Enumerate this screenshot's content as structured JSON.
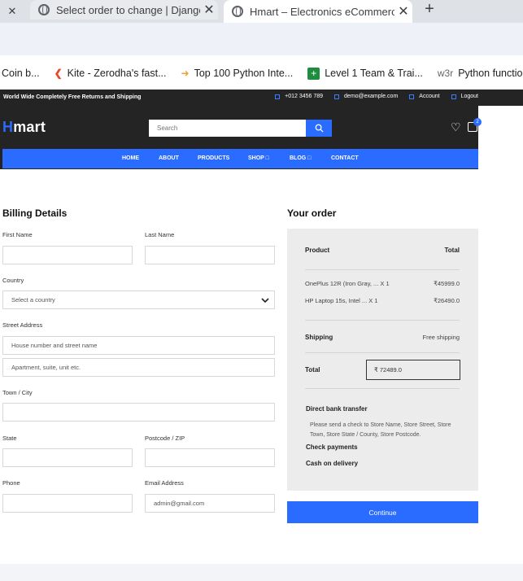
{
  "browser": {
    "tabs": [
      {
        "title": "",
        "close": "✕"
      },
      {
        "title": "Select order to change | Django",
        "close": "✕"
      },
      {
        "title": "Hmart – Electronics eCommerce",
        "close": "✕"
      }
    ],
    "new_tab": "+",
    "bookmarks": [
      {
        "label": "Coin b...",
        "icon": ""
      },
      {
        "label": "Kite - Zerodha's fast...",
        "icon": "kite-icon"
      },
      {
        "label": "Top 100 Python Inte...",
        "icon": "top-icon"
      },
      {
        "label": "Level 1 Team & Trai...",
        "icon": "level-icon"
      },
      {
        "label": "Python functions -",
        "icon": "w3r-icon",
        "icon_text": "w3r"
      }
    ]
  },
  "topstrip": {
    "promo": "World Wide Completely Free Returns and Shipping",
    "phone": "+012 3456 789",
    "email": "demo@example.com",
    "account": "Account",
    "logout": "Logout"
  },
  "header": {
    "logo_first": "H",
    "logo_rest": "mart",
    "search_placeholder": "Search",
    "cart_count": "2"
  },
  "nav": {
    "home": "HOME",
    "about": "ABOUT",
    "products": "PRODUCTS",
    "shop": "SHOP □",
    "blog": "BLOG □",
    "contact": "CONTACT"
  },
  "billing": {
    "heading": "Billing Details",
    "first_name_label": "First Name",
    "last_name_label": "Last Name",
    "country_label": "Country",
    "country_value": "Select a country",
    "street_label": "Street Address",
    "street_placeholder": "House number and street name",
    "apartment_placeholder": "Apartment, suite, unit etc.",
    "town_label": "Town / City",
    "state_label": "State",
    "postcode_label": "Postcode / ZIP",
    "phone_label": "Phone",
    "email_label": "Email Address",
    "email_value": "admin@gmail.com"
  },
  "order": {
    "heading": "Your order",
    "product_header": "Product",
    "total_header": "Total",
    "items": [
      {
        "name": "OnePlus 12R (Iron Gray, ... X 1",
        "price": "₹45999.0"
      },
      {
        "name": "HP Laptop 15s, Intel ... X 1",
        "price": "₹26490.0"
      }
    ],
    "shipping_label": "Shipping",
    "shipping_value": "Free shipping",
    "total_label": "Total",
    "total_value": "₹ 72489.0",
    "payment_bank": "Direct bank transfer",
    "payment_bank_desc": "Please send a check to Store Name, Store Street, Store Town, Store State / County, Store Postcode.",
    "payment_check": "Check payments",
    "payment_cod": "Cash on delivery",
    "continue_label": "Continue"
  },
  "colors": {
    "accent": "#2a6cff",
    "dark": "#242424",
    "order_bg": "#ececec"
  }
}
